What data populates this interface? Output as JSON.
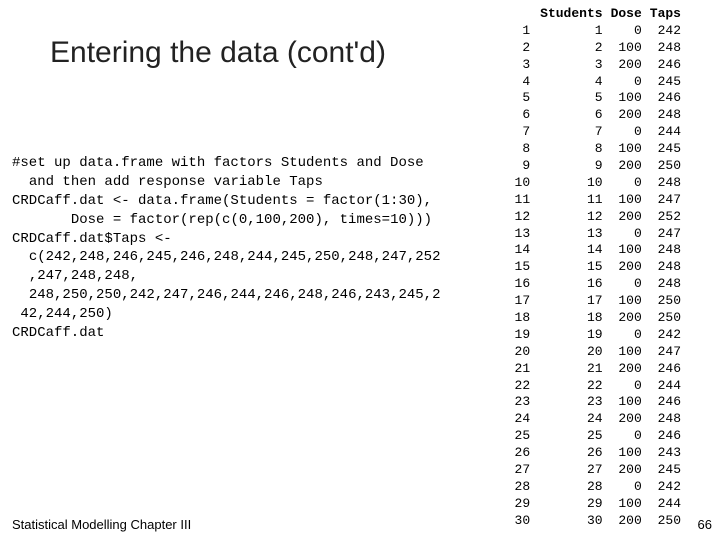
{
  "title": "Entering the data (cont'd)",
  "code": "#set up data.frame with factors Students and Dose\n  and then add response variable Taps\nCRDCaff.dat <- data.frame(Students = factor(1:30),\n       Dose = factor(rep(c(0,100,200), times=10)))\nCRDCaff.dat$Taps <-\n  c(242,248,246,245,246,248,244,245,250,248,247,252\n  ,247,248,248,\n  248,250,250,242,247,246,244,246,248,246,243,245,2\n 42,244,250)\nCRDCaff.dat",
  "footer": "Statistical Modelling  Chapter III",
  "pagenum": "66",
  "chart_data": {
    "type": "table",
    "title": "",
    "columns": [
      "",
      "Students",
      "Dose",
      "Taps"
    ],
    "rows": [
      [
        "1",
        "1",
        "0",
        "242"
      ],
      [
        "2",
        "2",
        "100",
        "248"
      ],
      [
        "3",
        "3",
        "200",
        "246"
      ],
      [
        "4",
        "4",
        "0",
        "245"
      ],
      [
        "5",
        "5",
        "100",
        "246"
      ],
      [
        "6",
        "6",
        "200",
        "248"
      ],
      [
        "7",
        "7",
        "0",
        "244"
      ],
      [
        "8",
        "8",
        "100",
        "245"
      ],
      [
        "9",
        "9",
        "200",
        "250"
      ],
      [
        "10",
        "10",
        "0",
        "248"
      ],
      [
        "11",
        "11",
        "100",
        "247"
      ],
      [
        "12",
        "12",
        "200",
        "252"
      ],
      [
        "13",
        "13",
        "0",
        "247"
      ],
      [
        "14",
        "14",
        "100",
        "248"
      ],
      [
        "15",
        "15",
        "200",
        "248"
      ],
      [
        "16",
        "16",
        "0",
        "248"
      ],
      [
        "17",
        "17",
        "100",
        "250"
      ],
      [
        "18",
        "18",
        "200",
        "250"
      ],
      [
        "19",
        "19",
        "0",
        "242"
      ],
      [
        "20",
        "20",
        "100",
        "247"
      ],
      [
        "21",
        "21",
        "200",
        "246"
      ],
      [
        "22",
        "22",
        "0",
        "244"
      ],
      [
        "23",
        "23",
        "100",
        "246"
      ],
      [
        "24",
        "24",
        "200",
        "248"
      ],
      [
        "25",
        "25",
        "0",
        "246"
      ],
      [
        "26",
        "26",
        "100",
        "243"
      ],
      [
        "27",
        "27",
        "200",
        "245"
      ],
      [
        "28",
        "28",
        "0",
        "242"
      ],
      [
        "29",
        "29",
        "100",
        "244"
      ],
      [
        "30",
        "30",
        "200",
        "250"
      ]
    ]
  }
}
